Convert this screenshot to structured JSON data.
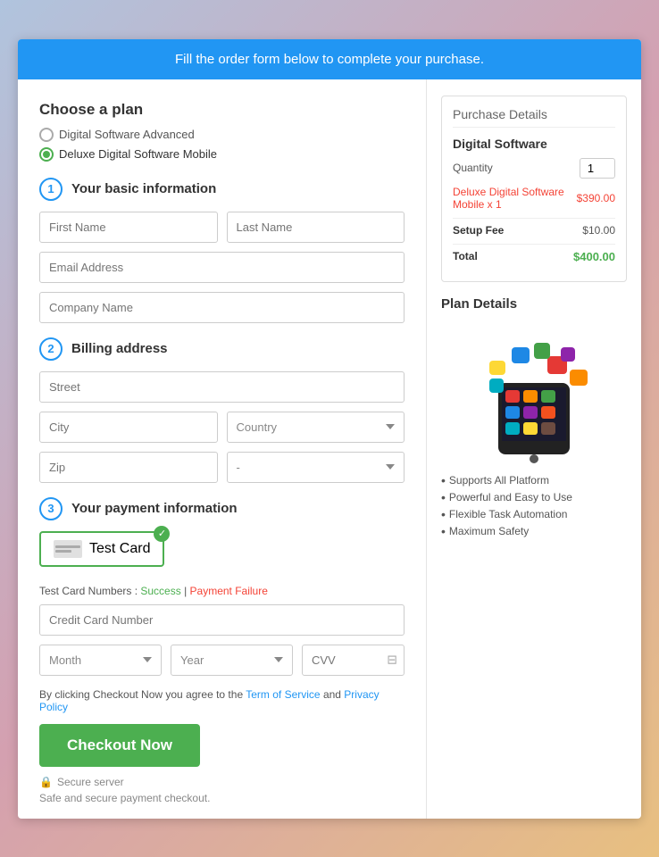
{
  "banner": {
    "text": "Fill the order form below to complete your purchase."
  },
  "plan": {
    "title": "Choose a plan",
    "options": [
      {
        "id": "digital-software-advanced",
        "label": "Digital Software Advanced",
        "selected": false
      },
      {
        "id": "deluxe-digital-software-mobile",
        "label": "Deluxe Digital Software Mobile",
        "selected": true
      }
    ]
  },
  "basic_info": {
    "step": "1",
    "title": "Your basic information",
    "fields": {
      "first_name_placeholder": "First Name",
      "last_name_placeholder": "Last Name",
      "email_placeholder": "Email Address",
      "company_placeholder": "Company Name"
    }
  },
  "billing": {
    "step": "2",
    "title": "Billing address",
    "fields": {
      "street_placeholder": "Street",
      "city_placeholder": "City",
      "country_placeholder": "Country",
      "zip_placeholder": "Zip",
      "state_placeholder": "-"
    }
  },
  "payment": {
    "step": "3",
    "title": "Your payment information",
    "card_label": "Test Card",
    "test_card_label": "Test Card Numbers : ",
    "success_link": "Success",
    "failure_link": "Payment Failure",
    "cc_placeholder": "Credit Card Number",
    "month_placeholder": "Month",
    "year_placeholder": "Year",
    "cvv_placeholder": "CVV",
    "terms_text": "By clicking Checkout Now you agree to the ",
    "terms_link": "Term of Service",
    "and_text": " and ",
    "privacy_link": "Privacy Policy",
    "checkout_label": "Checkout Now",
    "secure_label": "Secure server",
    "safe_label": "Safe and secure payment checkout."
  },
  "purchase_details": {
    "title": "Purchase Details",
    "product": "Digital Software",
    "quantity_label": "Quantity",
    "quantity_value": "1",
    "product_line": "Deluxe Digital Software Mobile x 1",
    "product_price": "$390.00",
    "setup_fee_label": "Setup Fee",
    "setup_fee_value": "$10.00",
    "total_label": "Total",
    "total_value": "$400.00"
  },
  "plan_details": {
    "title": "Plan Details",
    "features": [
      "Supports All Platform",
      "Powerful and Easy to Use",
      "Flexible Task Automation",
      "Maximum Safety"
    ]
  }
}
